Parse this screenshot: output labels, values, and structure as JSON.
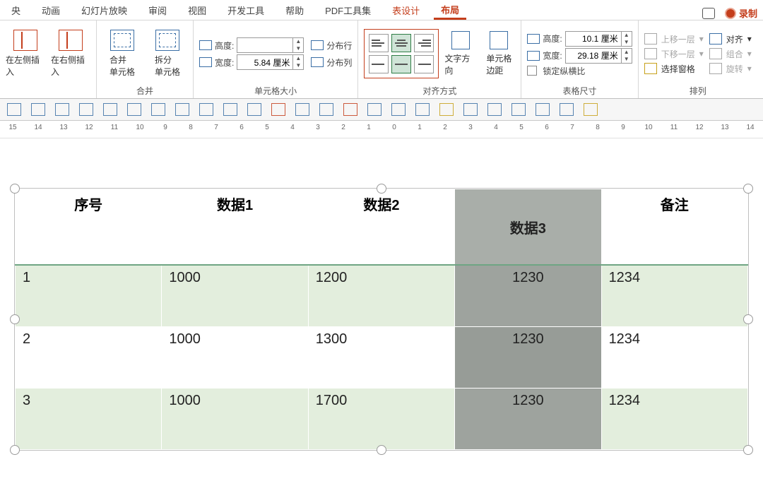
{
  "tabs": [
    "央",
    "动画",
    "幻灯片放映",
    "审阅",
    "视图",
    "开发工具",
    "帮助",
    "PDF工具集",
    "表设计",
    "布局"
  ],
  "active_tab_index": 9,
  "accent_tab_index": 8,
  "record_label": "录制",
  "ribbon": {
    "insert_left": "在左侧插入",
    "insert_right": "在右侧插入",
    "merge_cells": "合并\n单元格",
    "split_cells": "拆分\n单元格",
    "merge_group": "合并",
    "height_lbl": "高度:",
    "width_lbl": "宽度:",
    "cell_height": "",
    "cell_width": "5.84 厘米",
    "dist_rows": "分布行",
    "dist_cols": "分布列",
    "cellsize_group": "单元格大小",
    "text_dir": "文字方向",
    "cell_margins": "单元格\n边距",
    "align_group": "对齐方式",
    "tbl_height_lbl": "高度:",
    "tbl_width_lbl": "宽度:",
    "tbl_height": "10.1 厘米",
    "tbl_width": "29.18 厘米",
    "lock_aspect": "锁定纵横比",
    "size_group": "表格尺寸",
    "bring_fwd": "上移一层",
    "send_back": "下移一层",
    "selection_pane": "选择窗格",
    "align": "对齐",
    "group": "组合",
    "rotate": "旋转",
    "arrange_group": "排列"
  },
  "ruler_labels": [
    "15",
    "14",
    "13",
    "12",
    "11",
    "10",
    "9",
    "8",
    "7",
    "6",
    "5",
    "4",
    "3",
    "2",
    "1",
    "0",
    "1",
    "2",
    "3",
    "4",
    "5",
    "6",
    "7",
    "8",
    "9",
    "10",
    "11",
    "12",
    "13",
    "14"
  ],
  "table": {
    "headers": [
      "序号",
      "数据1",
      "数据2",
      "数据3",
      "备注"
    ],
    "rows": [
      {
        "c": [
          "1",
          "1000",
          "1200",
          "1230",
          "1234"
        ]
      },
      {
        "c": [
          "2",
          "1000",
          "1300",
          "1230",
          "1234"
        ]
      },
      {
        "c": [
          "3",
          "1000",
          "1700",
          "1230",
          "1234"
        ]
      }
    ]
  }
}
